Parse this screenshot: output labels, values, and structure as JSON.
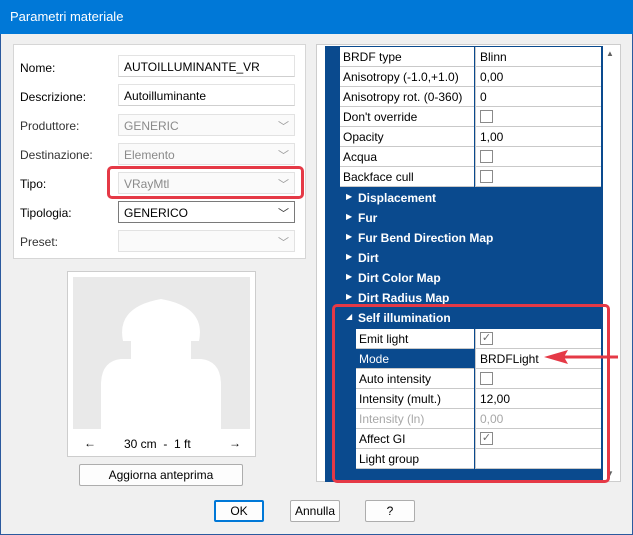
{
  "window": {
    "title": "Parametri materiale"
  },
  "form": {
    "fields": [
      {
        "label": "Nome:",
        "value": "AUTOILLUMINANTE_VR"
      },
      {
        "label": "Descrizione:",
        "value": "Autoilluminante"
      },
      {
        "label": "Produttore:",
        "value": "GENERIC"
      },
      {
        "label": "Destinazione:",
        "value": "Elemento"
      },
      {
        "label": "Tipo:",
        "value": "VRayMtl"
      },
      {
        "label": "Tipologia:",
        "value": "GENERICO"
      },
      {
        "label": "Preset:",
        "value": ""
      }
    ]
  },
  "preview": {
    "scale_text": "30 cm  -  1 ft",
    "left_arrow": "←",
    "right_arrow": "→",
    "update_label": "Aggiorna anteprima"
  },
  "properties": {
    "top_rows": [
      {
        "name": "BRDF type",
        "value": "Blinn"
      },
      {
        "name": "Anisotropy (-1.0,+1.0)",
        "value": "0,00"
      },
      {
        "name": "Anisotropy rot. (0-360)",
        "value": "0"
      },
      {
        "name": "Don't override",
        "value": ""
      },
      {
        "name": "Opacity",
        "value": "1,00"
      },
      {
        "name": "Acqua",
        "value": ""
      },
      {
        "name": "Backface cull",
        "value": ""
      }
    ],
    "categories": [
      "Displacement",
      "Fur",
      "Fur Bend Direction Map",
      "Dirt",
      "Dirt Color Map",
      "Dirt Radius Map"
    ],
    "self_illumination": {
      "title": "Self illumination",
      "rows": [
        {
          "name": "Emit light",
          "value": "✓"
        },
        {
          "name": "Mode",
          "value": "BRDFLight"
        },
        {
          "name": "Auto intensity",
          "value": ""
        },
        {
          "name": "Intensity (mult.)",
          "value": "12,00"
        },
        {
          "name": "Intensity (ln)",
          "value": "0,00"
        },
        {
          "name": "Affect GI",
          "value": "✓"
        },
        {
          "name": "Light group",
          "value": ""
        }
      ]
    }
  },
  "buttons": {
    "ok": "OK",
    "cancel": "Annulla",
    "help": "?"
  },
  "colors": {
    "accent": "#0078d7",
    "grid_blue": "#0a4a8e",
    "highlight_red": "#e53946"
  }
}
